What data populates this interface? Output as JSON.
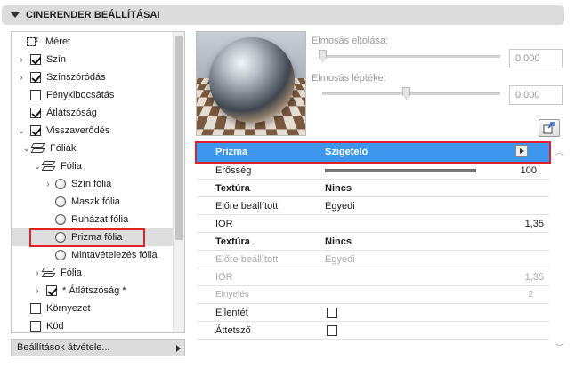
{
  "panel": {
    "title": "CINERENDER BEÁLLÍTÁSAI"
  },
  "tree": {
    "items": [
      {
        "label": "Méret"
      },
      {
        "label": "Szín"
      },
      {
        "label": "Színszóródás"
      },
      {
        "label": "Fénykibocsátás"
      },
      {
        "label": "Átlátszóság"
      },
      {
        "label": "Visszaverődés"
      },
      {
        "label": "Fóliák"
      },
      {
        "label": "Fólia"
      },
      {
        "label": "Szín fólia"
      },
      {
        "label": "Maszk fólia"
      },
      {
        "label": "Ruházat fólia"
      },
      {
        "label": "Prizma fólia"
      },
      {
        "label": "Mintavételezés fólia"
      },
      {
        "label": "Fólia"
      },
      {
        "label": "* Átlátszóság *"
      },
      {
        "label": "Környezet"
      },
      {
        "label": "Köd"
      }
    ],
    "bottom_button": "Beállítások átvétele..."
  },
  "preview": {
    "blur_offset_label": "Elmosás eltolása:",
    "blur_offset_value": "0,000",
    "blur_scale_label": "Elmosás léptéke:",
    "blur_scale_value": "0,000"
  },
  "props": {
    "rows": [
      {
        "key": "Prizma",
        "value": "Szigetelő"
      },
      {
        "key": "Erősség",
        "right": "100"
      },
      {
        "key": "Textúra",
        "value": "Nincs"
      },
      {
        "key": "Előre beállított",
        "value": "Egyedi"
      },
      {
        "key": "IOR",
        "right": "1,35"
      },
      {
        "key": "Textúra",
        "value": "Nincs"
      },
      {
        "key": "Előre beállított",
        "value": "Egyedi"
      },
      {
        "key": "IOR",
        "right": "1,35"
      },
      {
        "key": "Elnyelés",
        "right": "2"
      },
      {
        "key": "Ellentét"
      },
      {
        "key": "Áttetsző"
      }
    ]
  },
  "colors": {
    "selection": "#3d97ef",
    "highlight": "#e0212b"
  }
}
